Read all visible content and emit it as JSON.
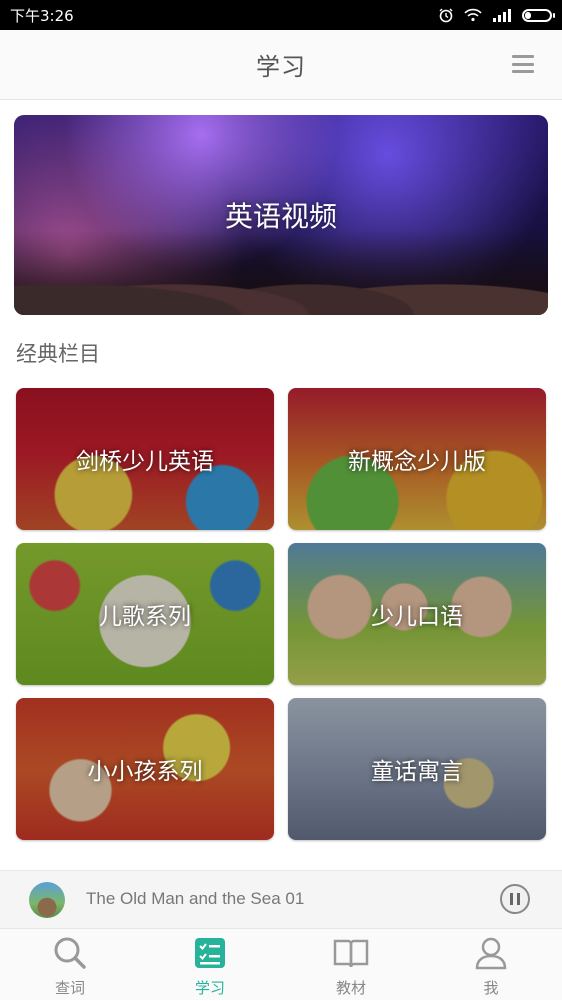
{
  "status": {
    "time": "下午3:26"
  },
  "header": {
    "title": "学习"
  },
  "banner": {
    "label": "英语视频"
  },
  "section": {
    "title": "经典栏目"
  },
  "tiles": [
    {
      "label": "剑桥少儿英语"
    },
    {
      "label": "新概念少儿版"
    },
    {
      "label": "儿歌系列"
    },
    {
      "label": "少儿口语"
    },
    {
      "label": "小小孩系列"
    },
    {
      "label": "童话寓言"
    }
  ],
  "player": {
    "track": "The Old Man and the Sea 01"
  },
  "tabs": [
    {
      "label": "查词",
      "icon": "search-icon"
    },
    {
      "label": "学习",
      "icon": "study-icon",
      "active": true
    },
    {
      "label": "教材",
      "icon": "book-icon"
    },
    {
      "label": "我",
      "icon": "person-icon"
    }
  ],
  "colors": {
    "accent": "#26b39a",
    "status_bar": "#000000"
  }
}
